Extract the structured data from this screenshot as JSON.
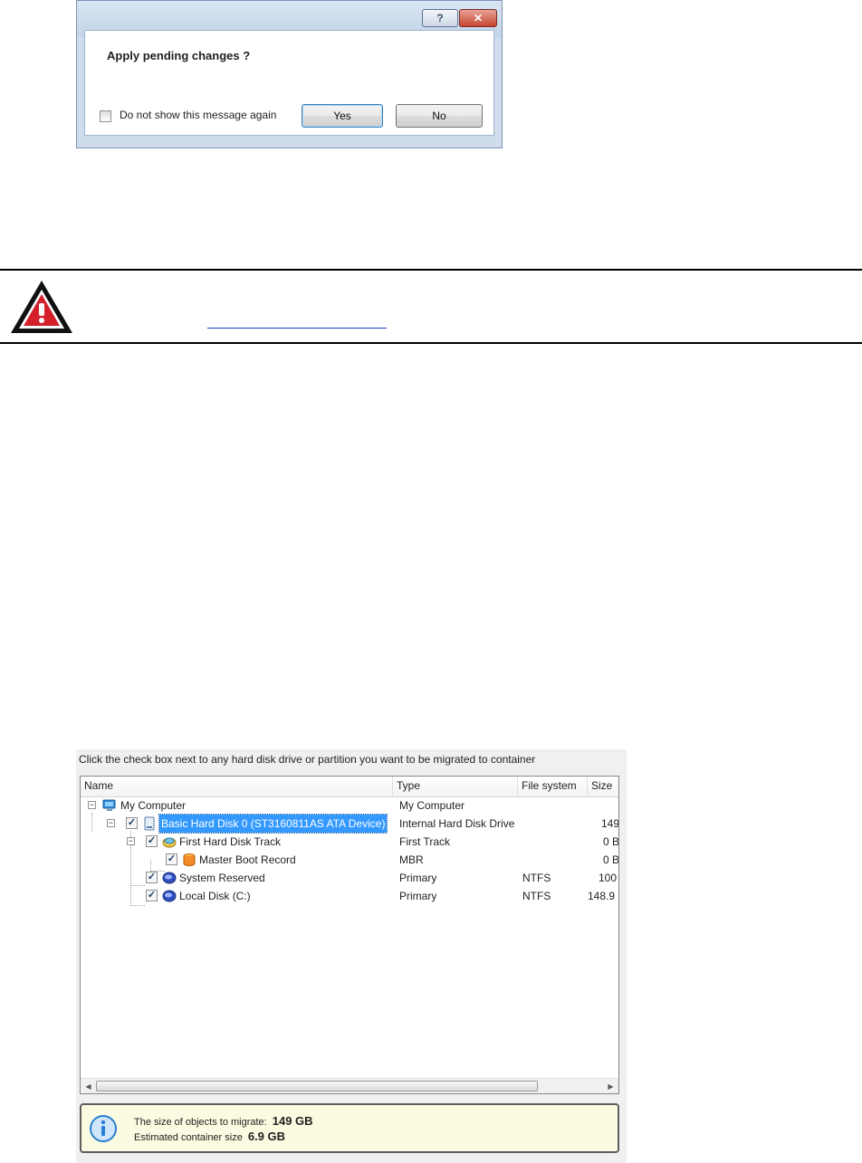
{
  "dialog": {
    "help_glyph": "?",
    "close_glyph": "✕",
    "message": "Apply pending changes ?",
    "checkbox_label": "Do not show this message again",
    "yes_label": "Yes",
    "no_label": "No"
  },
  "migration": {
    "caption": "Click the check box next to any hard disk drive or partition you want to be migrated to container",
    "columns": [
      "Name",
      "Type",
      "File system",
      "Size"
    ],
    "rows": [
      {
        "name": "My Computer",
        "type": "My Computer",
        "fs": "",
        "size": ""
      },
      {
        "name": "Basic Hard Disk 0 (ST3160811AS ATA Device)",
        "type": "Internal Hard Disk Drive",
        "fs": "",
        "size": "149"
      },
      {
        "name": "First Hard Disk Track",
        "type": "First Track",
        "fs": "",
        "size": "0 B"
      },
      {
        "name": "Master Boot Record",
        "type": "MBR",
        "fs": "",
        "size": "0 B"
      },
      {
        "name": "System Reserved",
        "type": "Primary",
        "fs": "NTFS",
        "size": "100"
      },
      {
        "name": "Local Disk (C:)",
        "type": "Primary",
        "fs": "NTFS",
        "size": "148.9"
      }
    ],
    "info": {
      "size_label": "The size of objects to migrate:",
      "size_value": "149 GB",
      "estimate_label": "Estimated container size",
      "estimate_value": "6.9 GB"
    }
  },
  "icons": {
    "warning": "warning-triangle-icon",
    "info": "info-icon"
  },
  "colors": {
    "selection": "#3399ff",
    "warning_red": "#d3202b",
    "info_blue": "#2a7fd4"
  }
}
